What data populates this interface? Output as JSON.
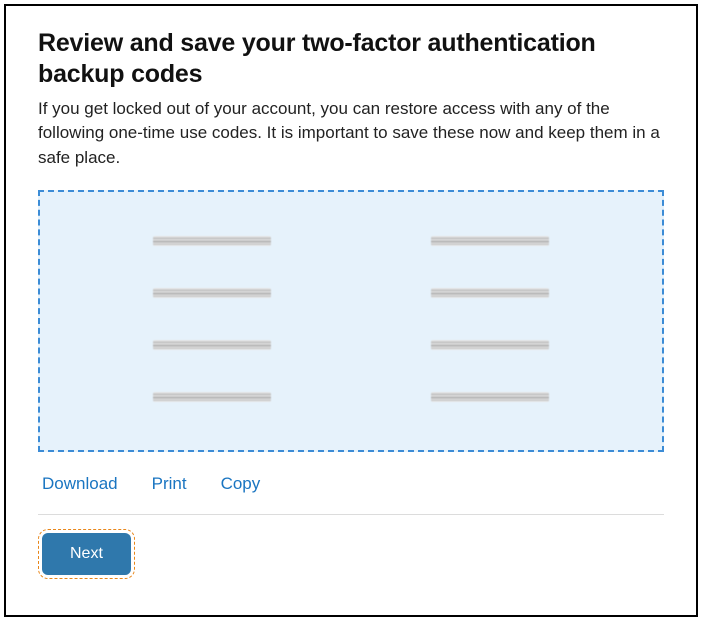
{
  "title": "Review and save your two-factor authentication backup codes",
  "subtitle": "If you get locked out of your account, you can restore access with any of the following one-time use codes. It is important to save these now and keep them in a safe place.",
  "codes": {
    "left": [
      "",
      "",
      "",
      ""
    ],
    "right": [
      "",
      "",
      "",
      ""
    ]
  },
  "actions": {
    "download": "Download",
    "print": "Print",
    "copy": "Copy"
  },
  "next": "Next"
}
